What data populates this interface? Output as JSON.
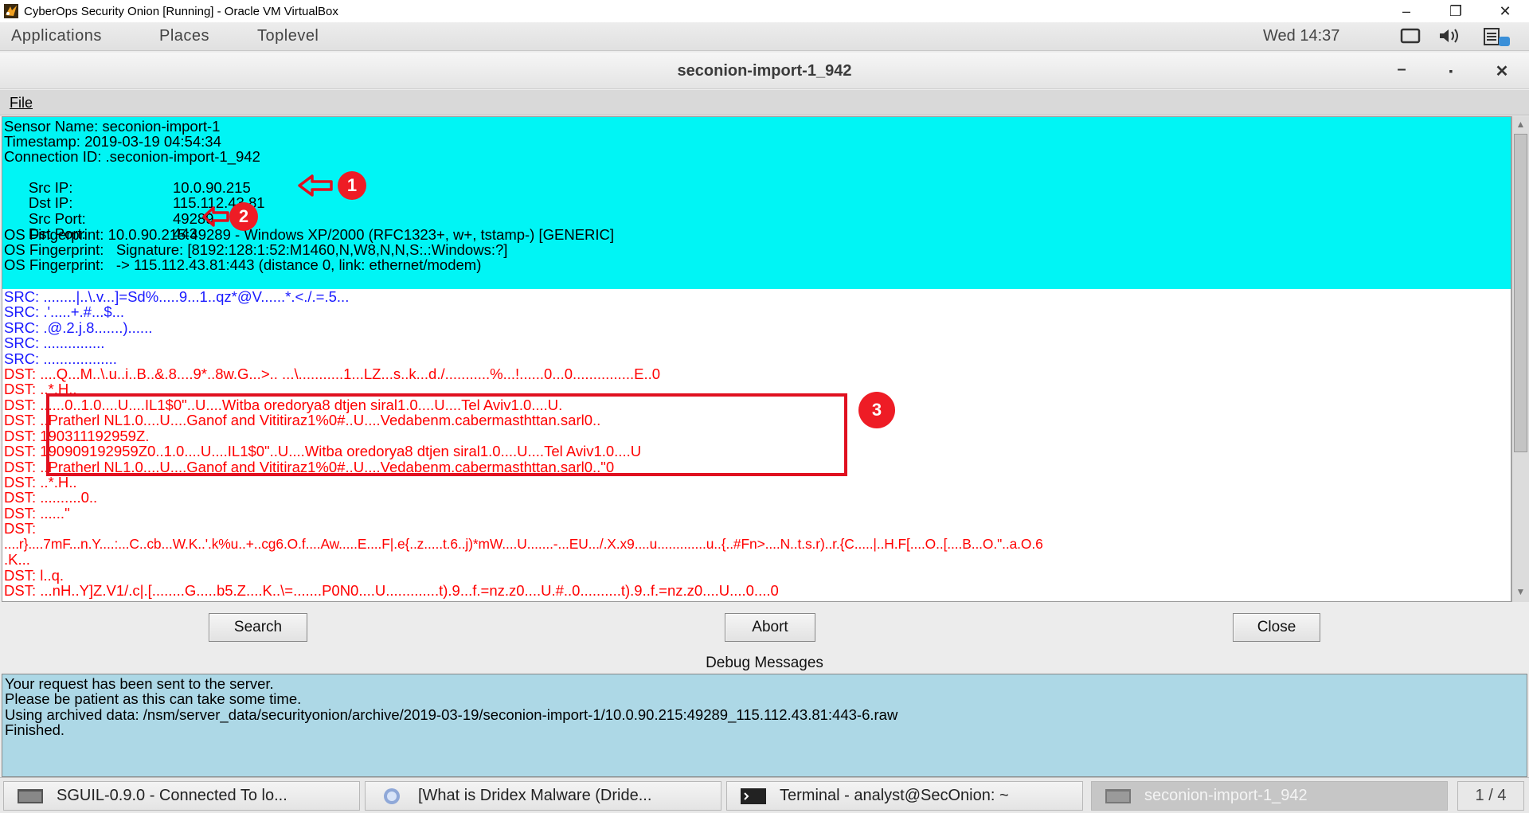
{
  "vbox": {
    "title": "CyberOps Security Onion [Running] - Oracle VM VirtualBox",
    "minimize": "–",
    "restore": "❐",
    "close": "✕"
  },
  "panel": {
    "menus": [
      "Applications",
      "Places",
      "Toplevel"
    ],
    "clock": "Wed 14:37",
    "icons": [
      "screen-icon",
      "volume-icon",
      "notes-icon"
    ]
  },
  "window": {
    "title": "seconion-import-1_942",
    "minimize": "–",
    "maximize": "▪",
    "close": "✕"
  },
  "menubar": {
    "file": "File"
  },
  "header": {
    "sensor": "Sensor Name: seconion-import-1",
    "timestamp": "Timestamp: 2019-03-19 04:54:34",
    "connection": "Connection ID: .seconion-import-1_942",
    "src_ip_label": "Src IP:",
    "src_ip": "10.0.90.215",
    "dst_ip_label": "Dst IP:",
    "dst_ip": "115.112.43.81",
    "src_port_label": "Src Port:",
    "src_port": "49289",
    "dst_port_label": "Dst Port:",
    "dst_port": "443",
    "os1": "OS Fingerprint: 10.0.90.215:49289 - Windows XP/2000 (RFC1323+, w+, tstamp-) [GENERIC]",
    "os2": "OS Fingerprint:   Signature: [8192:128:1:52:M1460,N,W8,N,N,S:.:Windows:?]",
    "os3": "OS Fingerprint:   -> 115.112.43.81:443 (distance 0, link: ethernet/modem)"
  },
  "transcript": [
    "SRC: ........|..\\.v...]=Sd%.....9...1..qz*@V......*.<./.=.5...",
    "SRC: .'.....+.#...$...",
    "SRC: .@.2.j.8.......)......",
    "SRC: ...............",
    "SRC: ..................",
    "DST: ....Q...M..\\.u..i..B..&.8....9*..8w.G...>.. ...\\...........1...LZ...s..k...d./...........%...!......0...0...............E..0",
    "DST: ..*.H..",
    "DST: ......0..1.0....U....IL1$0\"..U....Witba oredorya8 dtjen siral1.0....U....Tel Aviv1.0....U.",
    "DST: ..Pratherl NL1.0....U....Ganof and Vititiraz1%0#..U....Vedabenm.cabermasthttan.sarl0..",
    "DST: 190311192959Z.",
    "DST: 190909192959Z0..1.0....U....IL1$0\"..U....Witba oredorya8 dtjen siral1.0....U....Tel Aviv1.0....U",
    "DST: ..Pratherl NL1.0....U....Ganof and Vititiraz1%0#..U....Vedabenm.cabermasthttan.sarl0..\"0",
    "DST: ..*.H..",
    "DST: ..........0..",
    "DST: ......\"",
    "DST:",
    "....r}....7mF...n.Y....:...C..cb...W.K..'.k%u..+..cg6.O.f....Aw.....E....F|.e{..z.....t.6..j)*mW....U.......-...EU.../.X.x9....u.............u..{..#Fn>....N..t.s.r)..r.{C.....|..H.F[....O..[....B...O.\"..a.O.6",
    ".K...",
    "DST: l..q.",
    "DST: ...nH..Y]Z.V1/.c|.[........G.....b5.Z....K..\\=.......P0N0....U.............t).9...f.=nz.z0....U.#..0..........t).9..f.=nz.z0....U....0....0"
  ],
  "annotations": {
    "one": "1",
    "two": "2",
    "three": "3"
  },
  "buttons": {
    "search": "Search",
    "abort": "Abort",
    "close": "Close"
  },
  "debug": {
    "title": "Debug Messages",
    "lines": [
      "Your request has been sent to the server.",
      "Please be patient as this can take some time.",
      "Using archived data: /nsm/server_data/securityonion/archive/2019-03-19/seconion-import-1/10.0.90.215:49289_115.112.43.81:443-6.raw",
      "Finished."
    ]
  },
  "taskbar": {
    "tasks": [
      "SGUIL-0.9.0 - Connected To lo...",
      "[What is Dridex Malware (Dride...",
      "Terminal - analyst@SecOnion: ~",
      "seconion-import-1_942"
    ],
    "pager": "1 / 4"
  },
  "colors": {
    "header_bg": "#00f5f5",
    "src_text": "#1a1aff",
    "dst_text": "#ff0000",
    "debug_bg": "#add8e6",
    "annotation": "#ee1c25"
  }
}
